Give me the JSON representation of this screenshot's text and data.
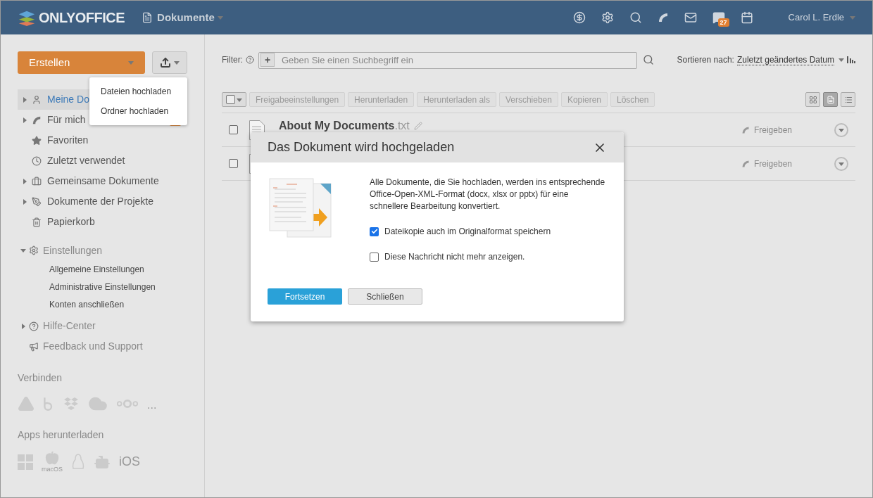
{
  "header": {
    "logo": "ONLYOFFICE",
    "module": "Dokumente",
    "chat_badge": "27",
    "user": "Carol L. Erdle"
  },
  "sidebar": {
    "create_button": "Erstellen",
    "upload_menu": [
      "Dateien hochladen",
      "Ordner hochladen"
    ],
    "nav": [
      {
        "label": "Meine Do",
        "selected": true,
        "expandable": true
      },
      {
        "label": "Für mich",
        "selected": false,
        "expandable": true
      },
      {
        "label": "Favoriten",
        "selected": false,
        "expandable": false
      },
      {
        "label": "Zuletzt verwendet",
        "selected": false,
        "expandable": false
      },
      {
        "label": "Gemeinsame Dokumente",
        "selected": false,
        "expandable": true
      },
      {
        "label": "Dokumente der Projekte",
        "selected": false,
        "expandable": true
      },
      {
        "label": "Papierkorb",
        "selected": false,
        "expandable": false
      }
    ],
    "settings": {
      "label": "Einstellungen",
      "expanded": true,
      "children": [
        {
          "label": "Allgemeine Einstellungen"
        },
        {
          "label": "Administrative Einstellungen"
        },
        {
          "label": "Konten anschließen"
        }
      ]
    },
    "help": {
      "label": "Hilfe-Center"
    },
    "feedback": {
      "label": "Feedback und Support"
    },
    "connect": {
      "title": "Verbinden",
      "more": "..."
    },
    "apps": {
      "title": "Apps herunterladen",
      "macos": "macOS",
      "ios": "iOS"
    }
  },
  "main": {
    "filter_label": "Filter:",
    "search": {
      "add_button": "+",
      "placeholder": "Geben Sie einen Suchbegriff ein"
    },
    "sort_label": "Sortieren nach:",
    "sort_value": "Zuletzt geändertes Datum",
    "toolbar": [
      "Freigabeeinstellungen",
      "Herunterladen",
      "Herunterladen als",
      "Verschieben",
      "Kopieren",
      "Löschen"
    ],
    "views": [
      {
        "selected": false
      },
      {
        "selected": true
      },
      {
        "selected": false
      }
    ],
    "files": [
      {
        "name": "About My Documents",
        "ext": ".txt",
        "share": "Freigeben",
        "checked": false
      },
      {
        "share": "Freigeben",
        "checked": false
      }
    ]
  },
  "dialog": {
    "title": "Das Dokument wird hochgeladen",
    "message": "Alle Dokumente, die Sie hochladen, werden ins entsprechende Office-Open-XML-Format (docx, xlsx or pptx) für eine schnellere Bearbeitung konvertiert.",
    "options": [
      {
        "label": "Dateikopie auch im Originalformat speichern",
        "checked": true
      },
      {
        "label": "Diese Nachricht nicht mehr anzeigen.",
        "checked": false
      }
    ],
    "buttons": [
      {
        "label": "Fortsetzen",
        "kind": "primary"
      },
      {
        "label": "Schließen",
        "kind": "secondary"
      }
    ]
  }
}
